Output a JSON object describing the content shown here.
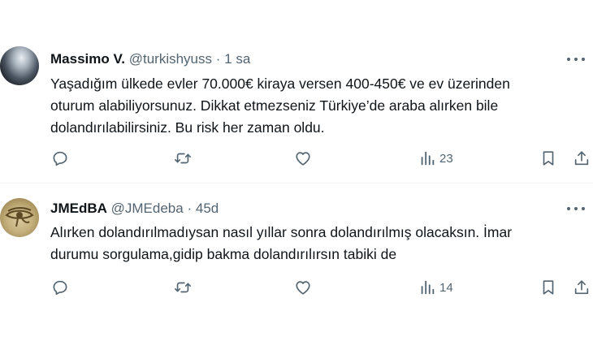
{
  "tweets": [
    {
      "display_name": "Massimo V.",
      "handle": "@turkishyuss",
      "separator": "·",
      "time": "1 sa",
      "text": "Yaşadığım ülkede evler 70.000€ kiraya versen 400-450€ ve ev üzerinden\noturum alabiliyorsunuz. Dikkat etmezseniz Türkiye’de araba alırken bile\ndolandırılabilirsiniz. Bu risk her zaman oldu.",
      "views": "23"
    },
    {
      "display_name": "JMEdBA",
      "handle": "@JMEdeba",
      "separator": "·",
      "time": "45d",
      "text": "Alırken dolandırılmadıysan nasıl yıllar sonra dolandırılmış olacaksın. İmar\ndurumu sorgulama,gidip bakma dolandırılırsın tabiki de",
      "views": "14"
    }
  ],
  "icons": {
    "more": "more-horizontal-icon",
    "reply": "reply-icon",
    "retweet": "retweet-icon",
    "like": "heart-icon",
    "views": "views-chart-icon",
    "bookmark": "bookmark-icon",
    "share": "share-icon"
  },
  "colors": {
    "text": "#0f1419",
    "muted": "#536471",
    "divider": "#eff3f4"
  }
}
